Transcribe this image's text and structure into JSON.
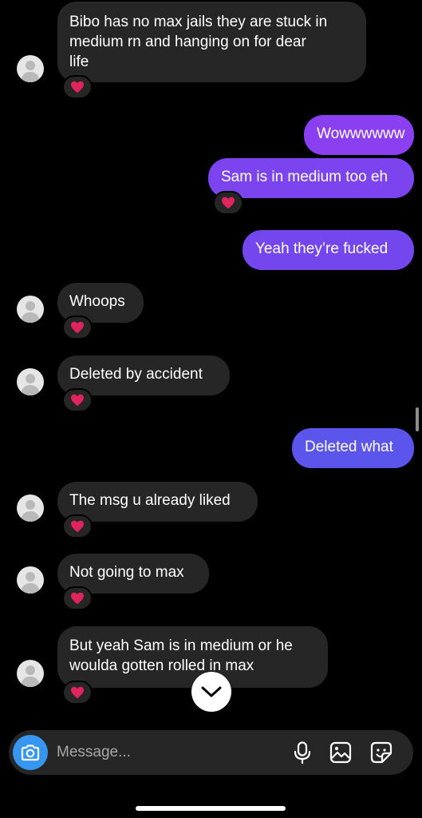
{
  "colors": {
    "background": "#000000",
    "incoming_bubble": "#262626",
    "outgoing_bubble_top": "#8a3ff0",
    "outgoing_bubble_bottom": "#5b55ec",
    "reaction": "#e0245e",
    "accent": "#3797f0"
  },
  "thread": {
    "messages": [
      {
        "from": "them",
        "text_lines": [
          "Bibo has no max jails they are stuck in",
          "medium rn and hanging on for dear",
          "life"
        ],
        "reaction": "red-heart"
      },
      {
        "from": "me",
        "text_lines": [
          "Wowwwwww"
        ],
        "reaction": null
      },
      {
        "from": "me",
        "text_lines": [
          "Sam is in medium too eh"
        ],
        "reaction": "red-heart"
      },
      {
        "from": "me",
        "text_lines": [
          "Yeah they’re fucked"
        ],
        "reaction": null
      },
      {
        "from": "them",
        "text_lines": [
          "Whoops"
        ],
        "reaction": "red-heart"
      },
      {
        "from": "them",
        "text_lines": [
          "Deleted by accident"
        ],
        "reaction": "red-heart"
      },
      {
        "from": "me",
        "text_lines": [
          "Deleted what"
        ],
        "reaction": null
      },
      {
        "from": "them",
        "text_lines": [
          "The msg u already liked"
        ],
        "reaction": "red-heart"
      },
      {
        "from": "them",
        "text_lines": [
          "Not going to max"
        ],
        "reaction": "red-heart"
      },
      {
        "from": "them",
        "text_lines": [
          "But yeah Sam is in medium or he",
          "woulda gotten rolled in max"
        ],
        "reaction": "red-heart"
      }
    ]
  },
  "composer": {
    "placeholder": "Message...",
    "icons": [
      "camera-icon",
      "microphone-icon",
      "gallery-icon",
      "sticker-icon"
    ]
  },
  "scroll_down_icon": "chevron-down-icon"
}
